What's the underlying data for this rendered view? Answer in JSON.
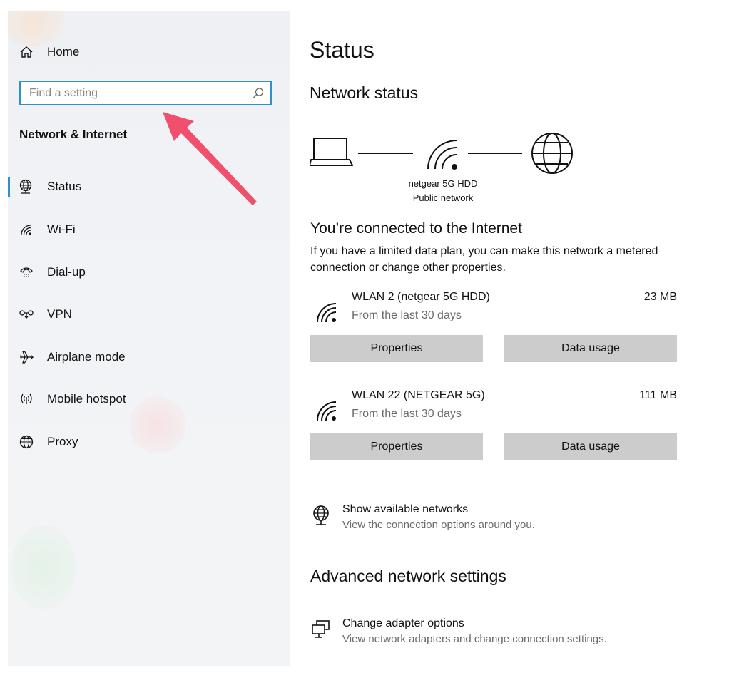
{
  "sidebar": {
    "home_label": "Home",
    "search_placeholder": "Find a setting",
    "section_title": "Network & Internet",
    "items": [
      {
        "label": "Status",
        "icon": "globe-status-icon"
      },
      {
        "label": "Wi-Fi",
        "icon": "wifi-icon"
      },
      {
        "label": "Dial-up",
        "icon": "dialup-icon"
      },
      {
        "label": "VPN",
        "icon": "vpn-icon"
      },
      {
        "label": "Airplane mode",
        "icon": "airplane-icon"
      },
      {
        "label": "Mobile hotspot",
        "icon": "hotspot-icon"
      },
      {
        "label": "Proxy",
        "icon": "globe-icon"
      }
    ]
  },
  "main": {
    "title": "Status",
    "network_status_heading": "Network status",
    "network_name": "netgear 5G HDD",
    "network_type": "Public network",
    "connected_heading": "You’re connected to the Internet",
    "connected_desc": "If you have a limited data plan, you can make this network a metered connection or change other properties.",
    "connections": [
      {
        "name": "WLAN 2 (netgear 5G HDD)",
        "sub": "From the last 30 days",
        "usage": "23 MB",
        "properties_label": "Properties",
        "data_usage_label": "Data usage"
      },
      {
        "name": "WLAN 22 (NETGEAR 5G)",
        "sub": "From the last 30 days",
        "usage": "111 MB",
        "properties_label": "Properties",
        "data_usage_label": "Data usage"
      }
    ],
    "show_networks_title": "Show available networks",
    "show_networks_sub": "View the connection options around you.",
    "advanced_heading": "Advanced network settings",
    "adapter_title": "Change adapter options",
    "adapter_sub": "View network adapters and change connection settings."
  },
  "colors": {
    "accent": "#2f8fcf",
    "annotation_arrow": "#f0506e",
    "button_bg": "#cccccc"
  }
}
